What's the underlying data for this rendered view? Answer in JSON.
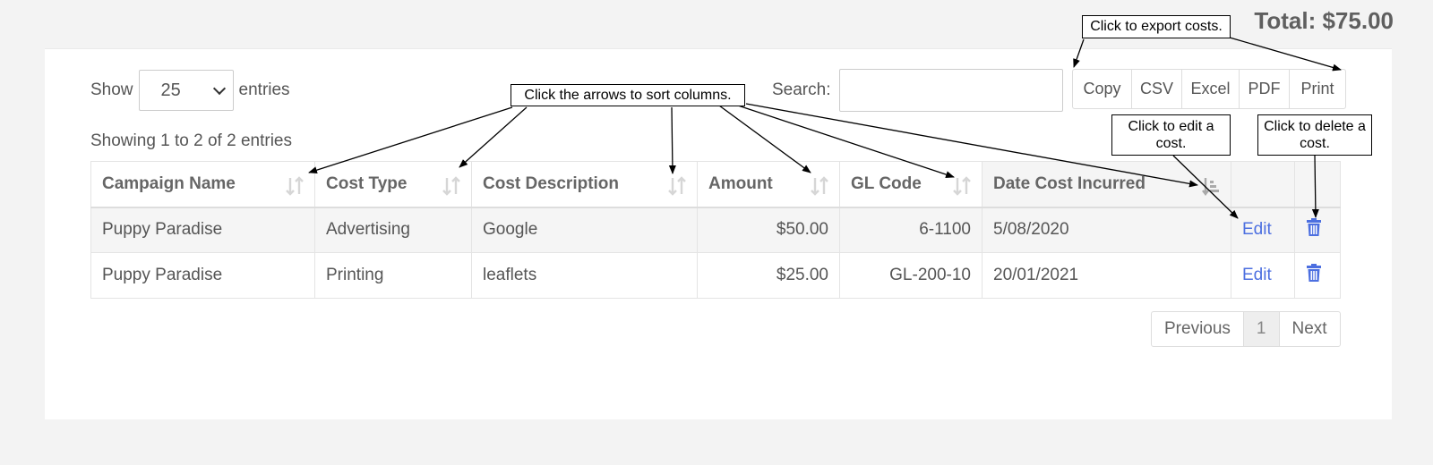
{
  "header": {
    "total": "Total: $75.00"
  },
  "controls": {
    "show_label": "Show",
    "entries_value": "25",
    "entries_label": "entries",
    "search_label": "Search:",
    "search_value": ""
  },
  "export": {
    "copy": "Copy",
    "csv": "CSV",
    "excel": "Excel",
    "pdf": "PDF",
    "print": "Print"
  },
  "info": "Showing 1 to 2 of 2 entries",
  "table": {
    "columns": [
      "Campaign Name",
      "Cost Type",
      "Cost Description",
      "Amount",
      "GL Code",
      "Date Cost Incurred"
    ],
    "edit_label": "Edit",
    "rows": [
      [
        "Puppy Paradise",
        "Advertising",
        "Google",
        "$50.00",
        "6-1100",
        "5/08/2020"
      ],
      [
        "Puppy Paradise",
        "Printing",
        "leaflets",
        "$25.00",
        "GL-200-10",
        "20/01/2021"
      ]
    ]
  },
  "pagination": {
    "previous": "Previous",
    "page": "1",
    "next": "Next"
  },
  "callouts": {
    "sort": "Click the arrows to sort columns.",
    "export": "Click to export costs.",
    "edit": "Click to edit a cost.",
    "delete": "Click to delete a cost."
  },
  "colors": {
    "link": "#4c6fe0",
    "text": "#555555",
    "header_bg": "#f5f5f5"
  }
}
